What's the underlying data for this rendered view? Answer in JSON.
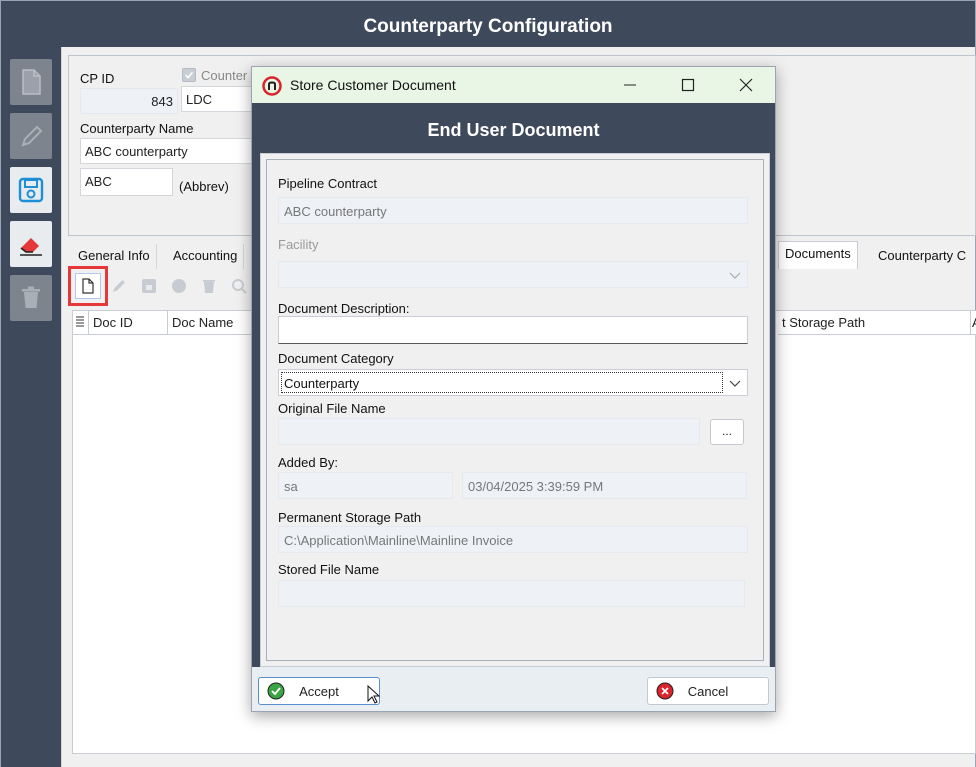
{
  "outer_window": {
    "title": "Counterparty Configuration"
  },
  "header": {
    "cp_id_label": "CP ID",
    "cp_id_value": "843",
    "counter_checkbox_label": "Counter",
    "type_value": "LDC",
    "name_label": "Counterparty Name",
    "name_value": "ABC counterparty",
    "abbrev_value": "ABC",
    "abbrev_label": "(Abbrev)"
  },
  "tabs": [
    {
      "label": "General Info"
    },
    {
      "label": "Accounting"
    },
    {
      "label": "Documents"
    },
    {
      "label": "Counterparty C"
    }
  ],
  "grid": {
    "columns": [
      "Doc ID",
      "Doc Name",
      "t Storage Path",
      "A"
    ]
  },
  "dialog": {
    "title": "Store Customer Document",
    "header": "End User Document",
    "pipeline_contract_label": "Pipeline Contract",
    "pipeline_contract_value": "ABC counterparty",
    "facility_label": "Facility",
    "facility_value": "",
    "description_label": "Document Description:",
    "description_value": "",
    "category_label": "Document Category",
    "category_value": "Counterparty",
    "original_file_label": "Original File Name",
    "original_file_value": "",
    "browse_label": "...",
    "added_by_label": "Added By:",
    "added_by_value": "sa",
    "added_date_value": "03/04/2025 3:39:59 PM",
    "storage_path_label": "Permanent Storage Path",
    "storage_path_value": "C:\\Application\\Mainline\\Mainline Invoice",
    "stored_file_label": "Stored File Name",
    "stored_file_value": "",
    "accept_label": "Accept",
    "cancel_label": "Cancel"
  },
  "colors": {
    "frame": "#3e4a5c",
    "dialog_titlebar": "#e9f6e6",
    "highlight": "#e4383b",
    "accept_green": "#3aa545",
    "cancel_red": "#d9232d"
  }
}
